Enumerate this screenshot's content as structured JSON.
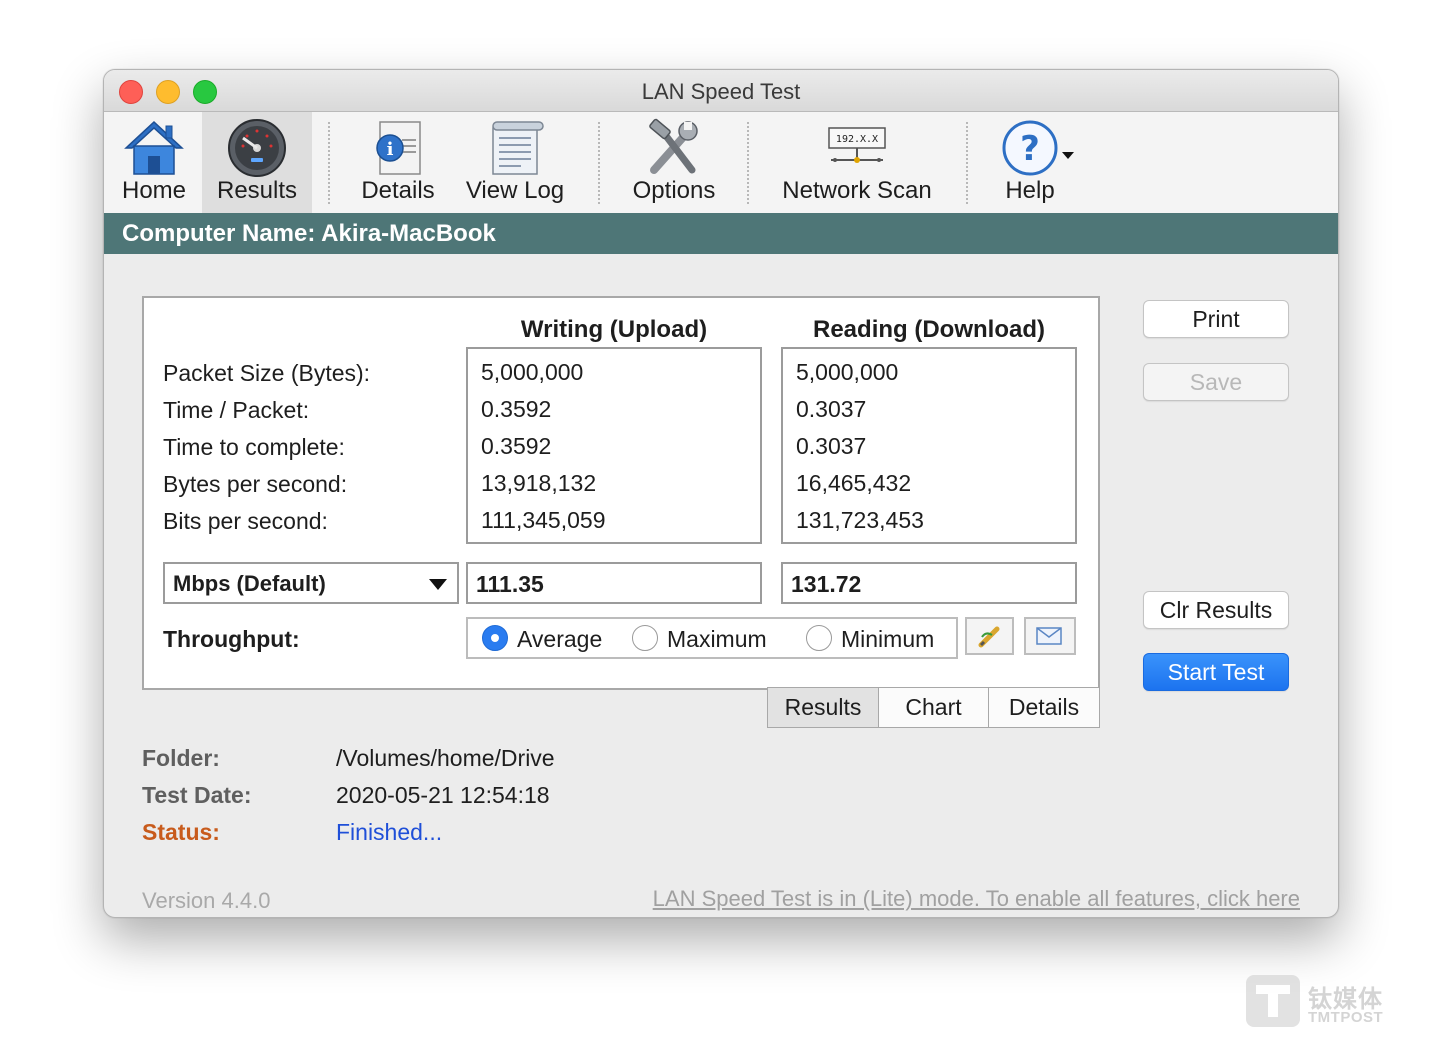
{
  "window": {
    "title": "LAN Speed Test"
  },
  "toolbar": {
    "items": [
      {
        "label": "Home",
        "icon": "home-icon"
      },
      {
        "label": "Results",
        "icon": "speedometer-icon",
        "selected": true
      },
      {
        "label": "Details",
        "icon": "details-icon"
      },
      {
        "label": "View Log",
        "icon": "log-icon"
      },
      {
        "label": "Options",
        "icon": "tools-icon"
      },
      {
        "label": "Network Scan",
        "icon": "network-scan-icon",
        "icon_text": "192.X.X"
      },
      {
        "label": "Help",
        "icon": "help-icon"
      }
    ]
  },
  "computer_bar": {
    "text": "Computer Name: Akira-MacBook",
    "color": "#4e7677"
  },
  "results": {
    "write_header": "Writing (Upload)",
    "read_header": "Reading (Download)",
    "rows": [
      {
        "label": "Packet Size (Bytes):",
        "write": "5,000,000",
        "read": "5,000,000"
      },
      {
        "label": "Time / Packet:",
        "write": "0.3592",
        "read": "0.3037"
      },
      {
        "label": "Time to complete:",
        "write": "0.3592",
        "read": "0.3037"
      },
      {
        "label": "Bytes per second:",
        "write": "13,918,132",
        "read": "16,465,432"
      },
      {
        "label": "Bits per second:",
        "write": "111,345,059",
        "read": "131,723,453"
      }
    ],
    "unit_select": "Mbps (Default)",
    "write_mbps": "111.35",
    "read_mbps": "131.72",
    "throughput_label": "Throughput:",
    "throughput_options": [
      {
        "label": "Average",
        "selected": true
      },
      {
        "label": "Maximum",
        "selected": false
      },
      {
        "label": "Minimum",
        "selected": false
      }
    ]
  },
  "tabs": [
    {
      "label": "Results",
      "active": true
    },
    {
      "label": "Chart",
      "active": false
    },
    {
      "label": "Details",
      "active": false
    }
  ],
  "side_buttons": {
    "print": "Print",
    "save": "Save",
    "clear": "Clr Results",
    "start": "Start Test"
  },
  "info": {
    "folder_label": "Folder:",
    "folder_value": "/Volumes/home/Drive",
    "date_label": "Test Date:",
    "date_value": "2020-05-21 12:54:18",
    "status_label": "Status:",
    "status_value": "Finished..."
  },
  "footer": {
    "version": "Version 4.4.0",
    "lite_link": "LAN Speed Test is in (Lite) mode.  To enable all features, click here"
  },
  "watermark": {
    "zh": "钛媒体",
    "en": "TMTPOST"
  },
  "colors": {
    "accent": "#2a7cf0",
    "status": "#c85b1c",
    "status_value": "#1f4fd8",
    "start_button": "#1c73ef"
  }
}
